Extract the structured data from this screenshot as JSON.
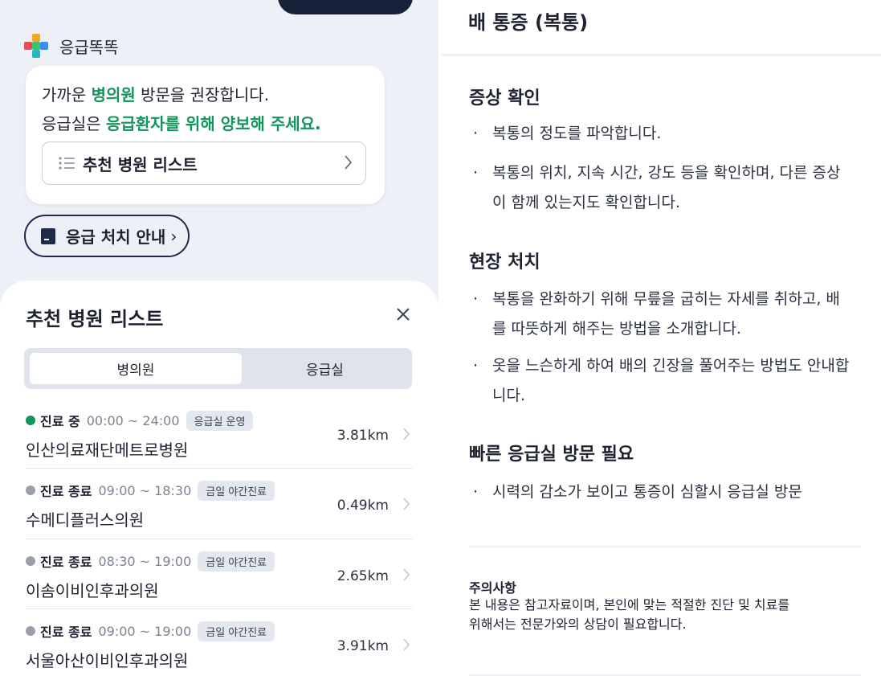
{
  "brand": {
    "name": "응급똑똑"
  },
  "notice": {
    "line1_prefix": "가까운 ",
    "line1_highlight": "병의원",
    "line1_suffix": " 방문을 권장합니다.",
    "line2_prefix": "응급실은 ",
    "line2_highlight": "응급환자를 위해 양보해 주세요.",
    "list_button_label": "추천 병원 리스트"
  },
  "guide_button": {
    "label": "응급 처치 안내",
    "chevron": "›"
  },
  "sheet": {
    "title": "추천 병원 리스트",
    "tabs": [
      {
        "label": "병의원",
        "active": true
      },
      {
        "label": "응급실",
        "active": false
      }
    ],
    "hospitals": [
      {
        "status": "진료 중",
        "status_color": "#12955a",
        "hours": "00:00 ~ 24:00",
        "badge": "응급실 운영",
        "name": "인산의료재단메트로병원",
        "distance": "3.81km"
      },
      {
        "status": "진료 종료",
        "status_color": "#9aa0ab",
        "hours": "09:00 ~ 18:30",
        "badge": "금일 야간진료",
        "name": "수메디플러스의원",
        "distance": "0.49km"
      },
      {
        "status": "진료 종료",
        "status_color": "#9aa0ab",
        "hours": "08:30 ~ 19:00",
        "badge": "금일 야간진료",
        "name": "이솜이비인후과의원",
        "distance": "2.65km"
      },
      {
        "status": "진료 종료",
        "status_color": "#9aa0ab",
        "hours": "09:00 ~ 19:00",
        "badge": "금일 야간진료",
        "name": "서울아산이비인후과의원",
        "distance": "3.91km"
      }
    ]
  },
  "detail": {
    "header": "배 통증 (복통)",
    "sections": [
      {
        "title": "증상 확인",
        "bullets": [
          "복통의 정도를 파악합니다.",
          "복통의 위치, 지속 시간, 강도 등을 확인하며, 다른 증상이 함께 있는지도 확인합니다."
        ]
      },
      {
        "title": "현장 처치",
        "bullets": [
          "복통을 완화하기 위해 무릎을 굽히는 자세를 취하고, 배를 따뜻하게 해주는 방법을 소개합니다.",
          "옷을 느슨하게 하여 배의 긴장을 풀어주는 방법도 안내합니다."
        ]
      },
      {
        "title": "빠른 응급실 방문 필요",
        "bullets": [
          "시력의 감소가 보이고 통증이 심할시 응급실 방문"
        ]
      }
    ],
    "caution_title": "주의사항",
    "caution_line1": "본 내용은 참고자료이며, 본인에 맞는 적절한 진단 및 치료를",
    "caution_line2": "위해서는 전문가와의 상담이 필요합니다."
  },
  "colors": {
    "accent_green": "#12955a",
    "navy": "#17213a",
    "panel_bg": "#edf0f6"
  }
}
